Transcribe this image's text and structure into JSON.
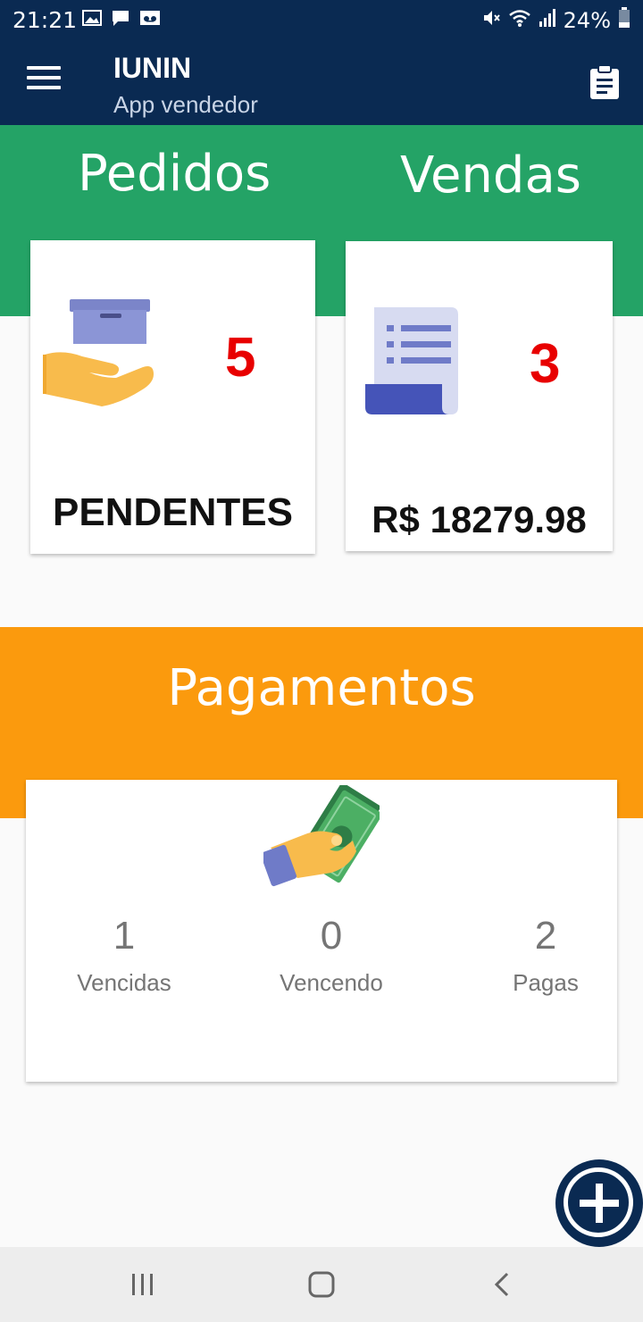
{
  "status_bar": {
    "time": "21:21",
    "battery": "24%",
    "icons": [
      "image-icon",
      "message-icon",
      "voicemail-icon",
      "mute-icon",
      "wifi-icon",
      "signal-icon",
      "battery-icon"
    ]
  },
  "app_bar": {
    "title": "IUNIN",
    "subtitle": "App vendedor",
    "left_icon": "menu-icon",
    "right_icon": "clipboard-icon"
  },
  "pedidos": {
    "title": "Pedidos",
    "count": "5",
    "label": "PENDENTES",
    "icon": "package-hand-icon"
  },
  "vendas": {
    "title": "Vendas",
    "count": "3",
    "label": "R$ 18279.98",
    "icon": "receipt-icon"
  },
  "pagamentos": {
    "title": "Pagamentos",
    "icon": "money-hand-icon",
    "stats": [
      {
        "value": "1",
        "label": "Vencidas"
      },
      {
        "value": "0",
        "label": "Vencendo"
      },
      {
        "value": "2",
        "label": "Pagas"
      }
    ]
  },
  "fab": {
    "icon": "add-icon"
  },
  "nav_bar": {
    "icons": [
      "recents-icon",
      "home-icon",
      "back-icon"
    ]
  },
  "colors": {
    "primary": "#0a2a52",
    "green": "#24a366",
    "orange": "#fb9a0d",
    "count_red": "#e80000"
  }
}
